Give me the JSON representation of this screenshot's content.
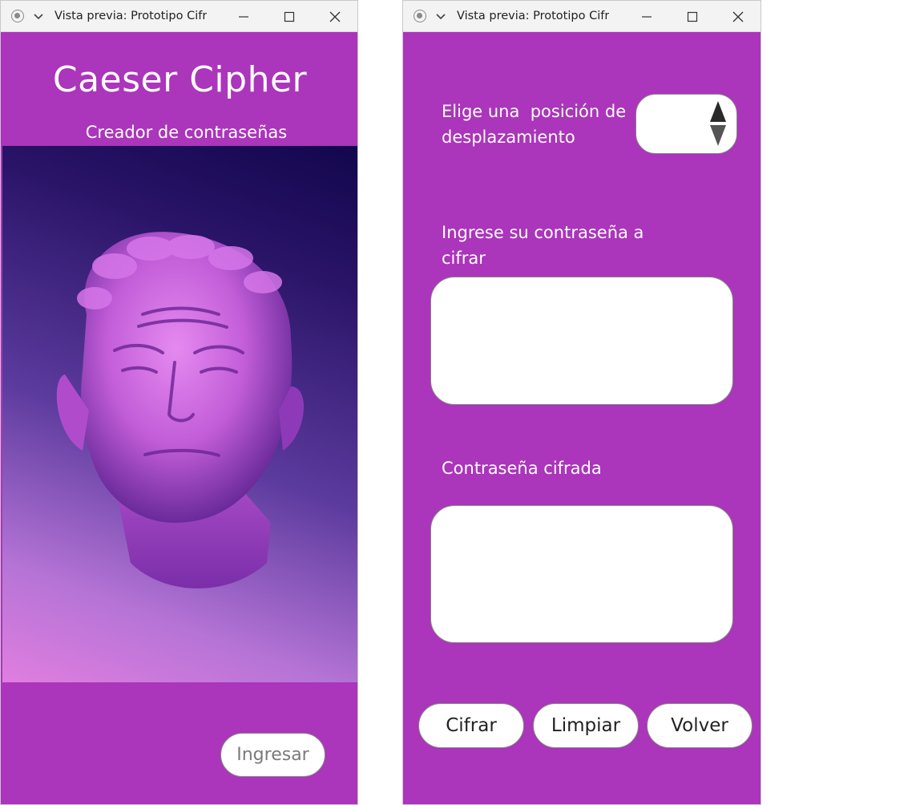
{
  "window_left": {
    "title": "Vista previa: Prototipo Cifr...",
    "app_title": "Caeser Cipher",
    "subtitle": "Creador de contraseñas",
    "enter_button": "Ingresar",
    "bg_color": "#ab35bb"
  },
  "window_right": {
    "title": "Vista previa: Prototipo Cifr...",
    "shift_label_line1": "Elige una  posición de",
    "shift_label_line2": "desplazamiento",
    "input_label_line1": "Ingrese su contraseña a",
    "input_label_line2": "cifrar",
    "input_value": "",
    "output_label": "Contraseña cifrada",
    "output_value": "",
    "buttons": {
      "encrypt": "Cifrar",
      "clear": "Limpiar",
      "back": "Volver"
    },
    "bg_color": "#ab35bb"
  },
  "icons": {
    "record": "record-icon",
    "chevron": "chevron-down-icon",
    "minimize": "minimize-icon",
    "maximize": "maximize-icon",
    "close": "close-icon",
    "spinner": "spinner-arrows-icon",
    "hero": "roman-bust-image"
  }
}
